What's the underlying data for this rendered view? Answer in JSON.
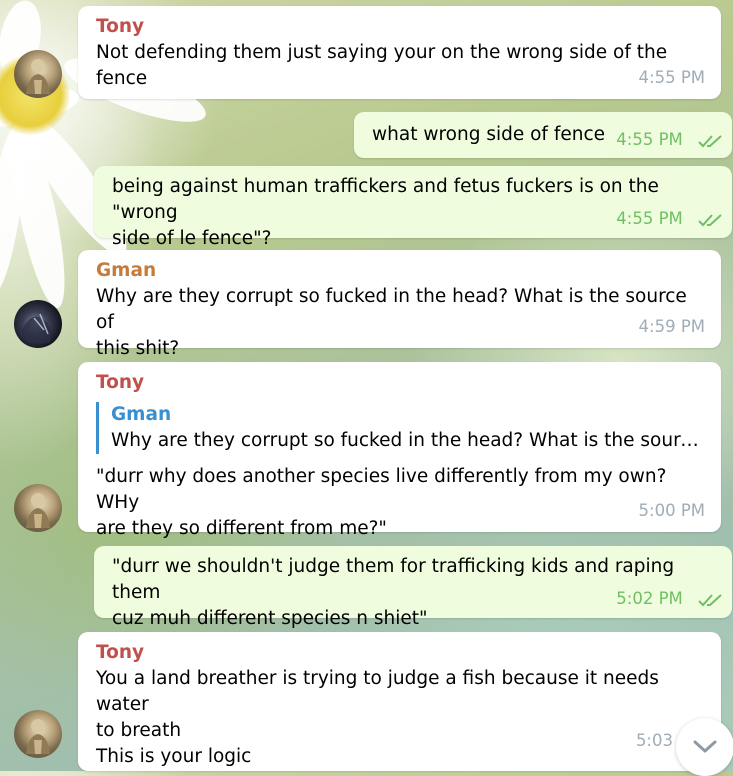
{
  "messages": [
    {
      "direction": "in",
      "sender": "Tony",
      "text": "Not defending them just saying your on the wrong side of the fence",
      "time": "4:55 PM"
    },
    {
      "direction": "out",
      "text": "what wrong side of fence",
      "time": "4:55 PM",
      "status": "read"
    },
    {
      "direction": "out",
      "text_line1": "being against human traffickers and fetus fuckers is on the \"wrong",
      "text_line2": "side of le fence\"?",
      "time": "4:55 PM",
      "status": "read"
    },
    {
      "direction": "in",
      "sender": "Gman",
      "text_line1": "Why are they corrupt so fucked in the head? What is the source of",
      "text_line2": "this shit?",
      "time": "4:59 PM"
    },
    {
      "direction": "in",
      "sender": "Tony",
      "reply": {
        "sender": "Gman",
        "text": "Why are they corrupt so fucked in the head? What is the source ..."
      },
      "text_line1": "\"durr why does another species live differently from my own? WHy",
      "text_line2": "are they so different from me?\"",
      "time": "5:00 PM"
    },
    {
      "direction": "out",
      "text_line1": "\"durr we shouldn't judge them for trafficking kids and raping them",
      "text_line2": "cuz muh different species n shiet\"",
      "time": "5:02 PM",
      "status": "read"
    },
    {
      "direction": "in",
      "sender": "Tony",
      "text_line1": "You a land breather is trying to judge a fish because it needs water",
      "text_line2": "to breath",
      "text_line3": "This is your logic",
      "time": "5:03"
    }
  ],
  "icons": {
    "read_status": "double-check-icon",
    "scroll_down": "chevron-down-icon"
  },
  "colors": {
    "incoming_bubble": "#ffffff",
    "outgoing_bubble": "#effdde",
    "tony_name": "#c0504c",
    "gman_name": "#c57b3c",
    "reply_accent": "#3a8fd0",
    "read_check": "#6fbf63"
  }
}
